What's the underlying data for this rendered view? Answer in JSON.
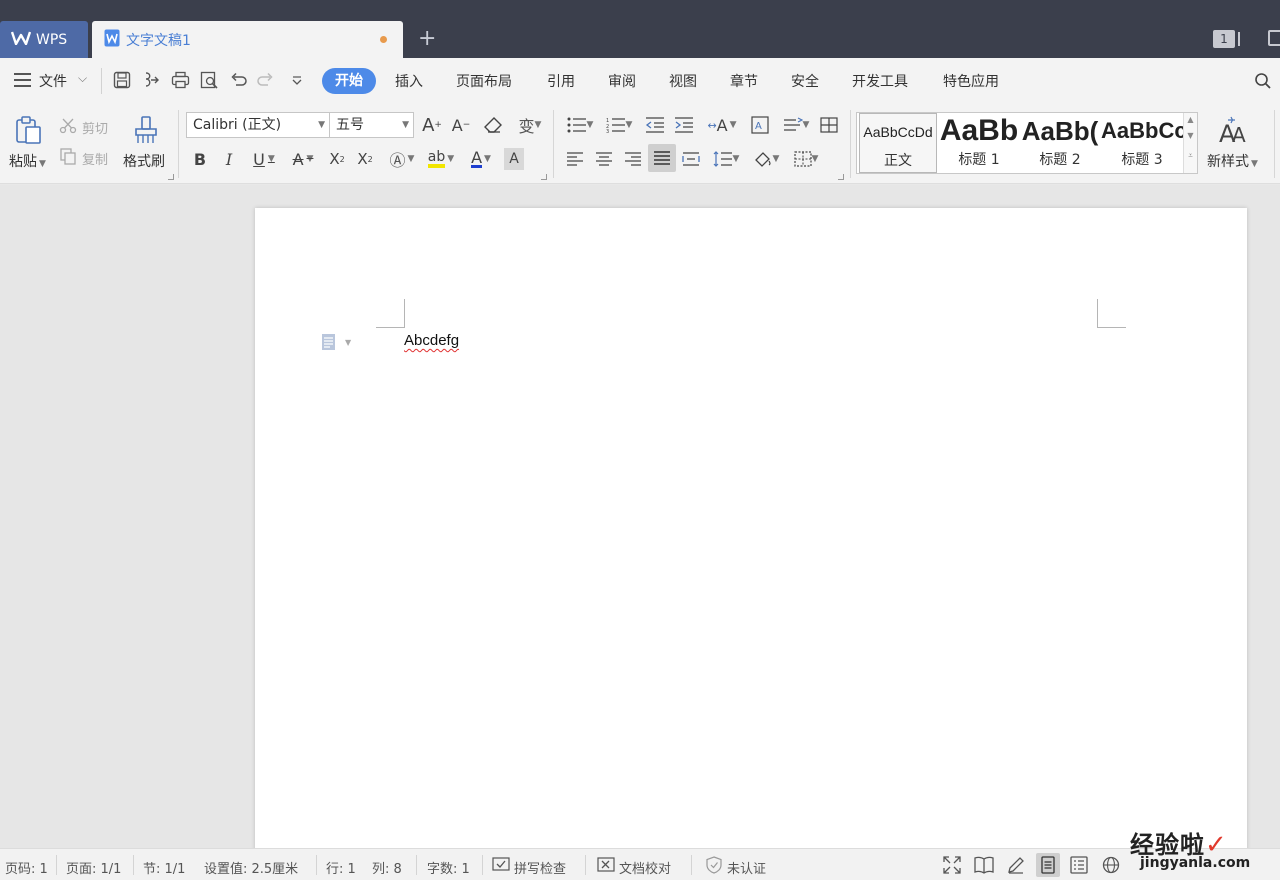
{
  "titlebar": {
    "app_tab": "WPS",
    "doc_tab": "文字文稿1",
    "window_count": "1"
  },
  "menubar": {
    "file": "文件",
    "tabs": [
      "开始",
      "插入",
      "页面布局",
      "引用",
      "审阅",
      "视图",
      "章节",
      "安全",
      "开发工具",
      "特色应用"
    ],
    "active_tab": "开始"
  },
  "ribbon": {
    "paste": "粘贴",
    "cut": "剪切",
    "copy": "复制",
    "format_painter": "格式刷",
    "font_name": "Calibri (正文)",
    "font_size": "五号",
    "styles": [
      {
        "sample": "AaBbCcDd",
        "label": "正文"
      },
      {
        "sample": "AaBb",
        "label": "标题 1"
      },
      {
        "sample": "AaBb(",
        "label": "标题 2"
      },
      {
        "sample": "AaBbCc",
        "label": "标题 3"
      }
    ],
    "new_style": "新样式"
  },
  "document": {
    "text": "Abcdefg"
  },
  "statusbar": {
    "page_num": "页码: 1",
    "pages": "页面: 1/1",
    "section": "节: 1/1",
    "setting": "设置值: 2.5厘米",
    "row": "行: 1",
    "col": "列: 8",
    "word_count": "字数: 1",
    "spell_check": "拼写检查",
    "doc_proof": "文档校对",
    "certify": "未认证"
  },
  "watermark": {
    "line1": "经验啦",
    "line2": "jingyanla.com"
  },
  "colors": {
    "titlebar": "#3b3f4c",
    "accent": "#4d8ae8",
    "wps_tab": "#4e6aa6",
    "modified_dot": "#e89a4c"
  }
}
